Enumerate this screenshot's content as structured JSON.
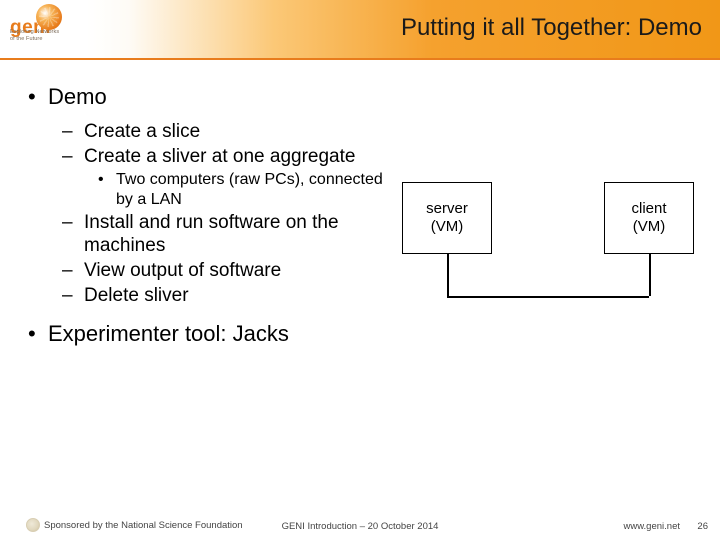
{
  "logo": {
    "word": "geni",
    "tag1": "Exploring Networks",
    "tag2": "of the Future"
  },
  "title": "Putting it all Together: Demo",
  "bullets": {
    "l1a": "Demo",
    "l2a": "Create a slice",
    "l2b": "Create a sliver at one aggregate",
    "l3a": "Two computers (raw PCs), connected by a LAN",
    "l2c": "Install and run software on the machines",
    "l2d": "View output of software",
    "l2e": "Delete sliver",
    "l1b": "Experimenter tool: Jacks"
  },
  "diagram": {
    "server_l1": "server",
    "server_l2": "(VM)",
    "client_l1": "client",
    "client_l2": "(VM)"
  },
  "footer": {
    "left": "Sponsored by the National Science Foundation",
    "mid": "GENI Introduction – 20 October 2014",
    "right": "www.geni.net",
    "page": "26"
  }
}
